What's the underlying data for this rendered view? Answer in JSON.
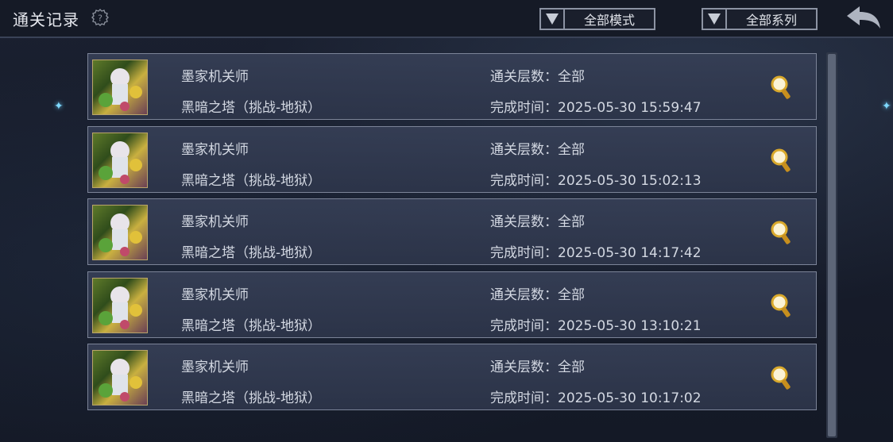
{
  "header": {
    "title": "通关记录",
    "mode_dropdown": "全部模式",
    "series_dropdown": "全部系列"
  },
  "icons": {
    "help": "help-gear-question-icon",
    "dropdown_arrow": "triangle-down-icon",
    "back": "back-arrow-icon",
    "detail": "magnifier-icon"
  },
  "colors": {
    "row_bg": "#353e55",
    "row_border": "#7c8498",
    "accent_gold": "#d9a92c",
    "star": "#7fd9ff"
  },
  "records": [
    {
      "name": "墨家机关师",
      "stage": "黑暗之塔（挑战-地狱）",
      "floors": "通关层数：全部",
      "time": "完成时间：2025-05-30 15:59:47"
    },
    {
      "name": "墨家机关师",
      "stage": "黑暗之塔（挑战-地狱）",
      "floors": "通关层数：全部",
      "time": "完成时间：2025-05-30 15:02:13"
    },
    {
      "name": "墨家机关师",
      "stage": "黑暗之塔（挑战-地狱）",
      "floors": "通关层数：全部",
      "time": "完成时间：2025-05-30 14:17:42"
    },
    {
      "name": "墨家机关师",
      "stage": "黑暗之塔（挑战-地狱）",
      "floors": "通关层数：全部",
      "time": "完成时间：2025-05-30 13:10:21"
    },
    {
      "name": "墨家机关师",
      "stage": "黑暗之塔（挑战-地狱）",
      "floors": "通关层数：全部",
      "time": "完成时间：2025-05-30 10:17:02"
    }
  ]
}
